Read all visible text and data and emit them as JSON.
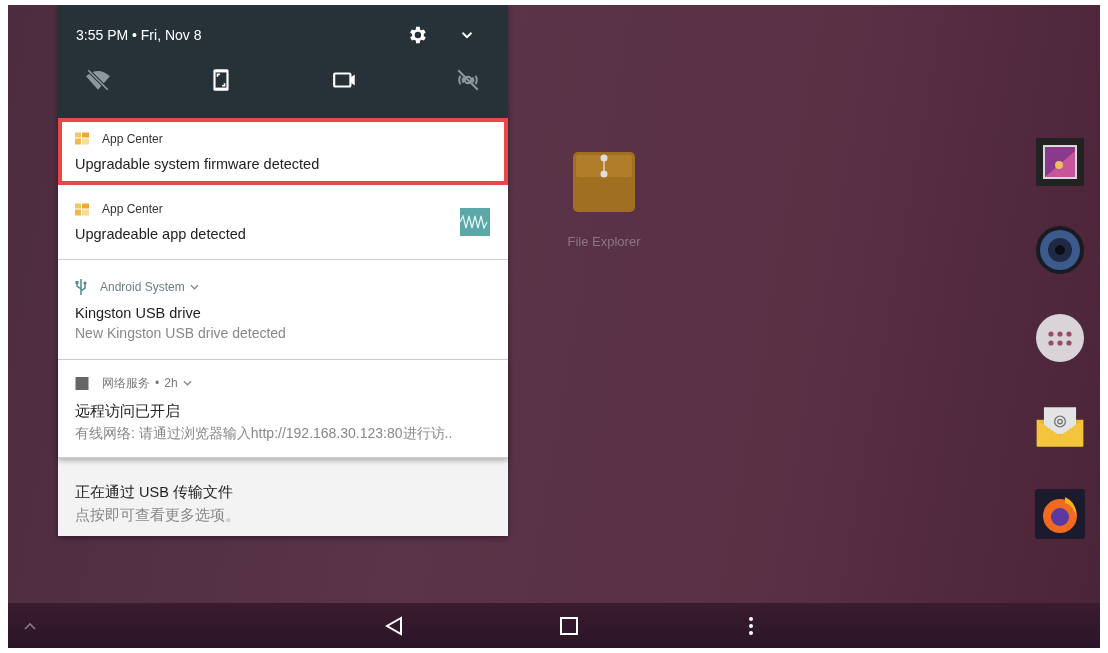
{
  "status": {
    "time": "3:55 PM",
    "separator": "•",
    "date": "Fri, Nov 8"
  },
  "quick_tiles": [
    {
      "kind": "wifi",
      "on": false
    },
    {
      "kind": "screen",
      "on": true
    },
    {
      "kind": "video",
      "on": true
    },
    {
      "kind": "location",
      "on": false
    }
  ],
  "notifications": [
    {
      "kind": "appcenter",
      "app": "App Center",
      "title": "Upgradable system firmware detected",
      "highlighted": true,
      "thumbnail": false
    },
    {
      "kind": "appcenter",
      "app": "App Center",
      "title": "Upgradeable app detected",
      "highlighted": false,
      "thumbnail": true
    },
    {
      "kind": "usb",
      "app": "Android System",
      "expandable": true,
      "title": "Kingston USB drive",
      "text": "New Kingston USB drive detected",
      "highlighted": false,
      "thumbnail": false
    },
    {
      "kind": "service",
      "app": "网络服务",
      "separator": "•",
      "time": "2h",
      "expandable": true,
      "title": "远程访问已开启",
      "text": "有线网络: 请通过浏览器输入http://192.168.30.123:80进行访..",
      "highlighted": false,
      "thumbnail": false
    },
    {
      "kind": "covered",
      "title": "正在通过 USB 传输文件",
      "text": "点按即可查看更多选项。",
      "highlighted": false,
      "thumbnail": false
    }
  ],
  "desktop_icons": [
    {
      "label": "File Explorer"
    }
  ]
}
